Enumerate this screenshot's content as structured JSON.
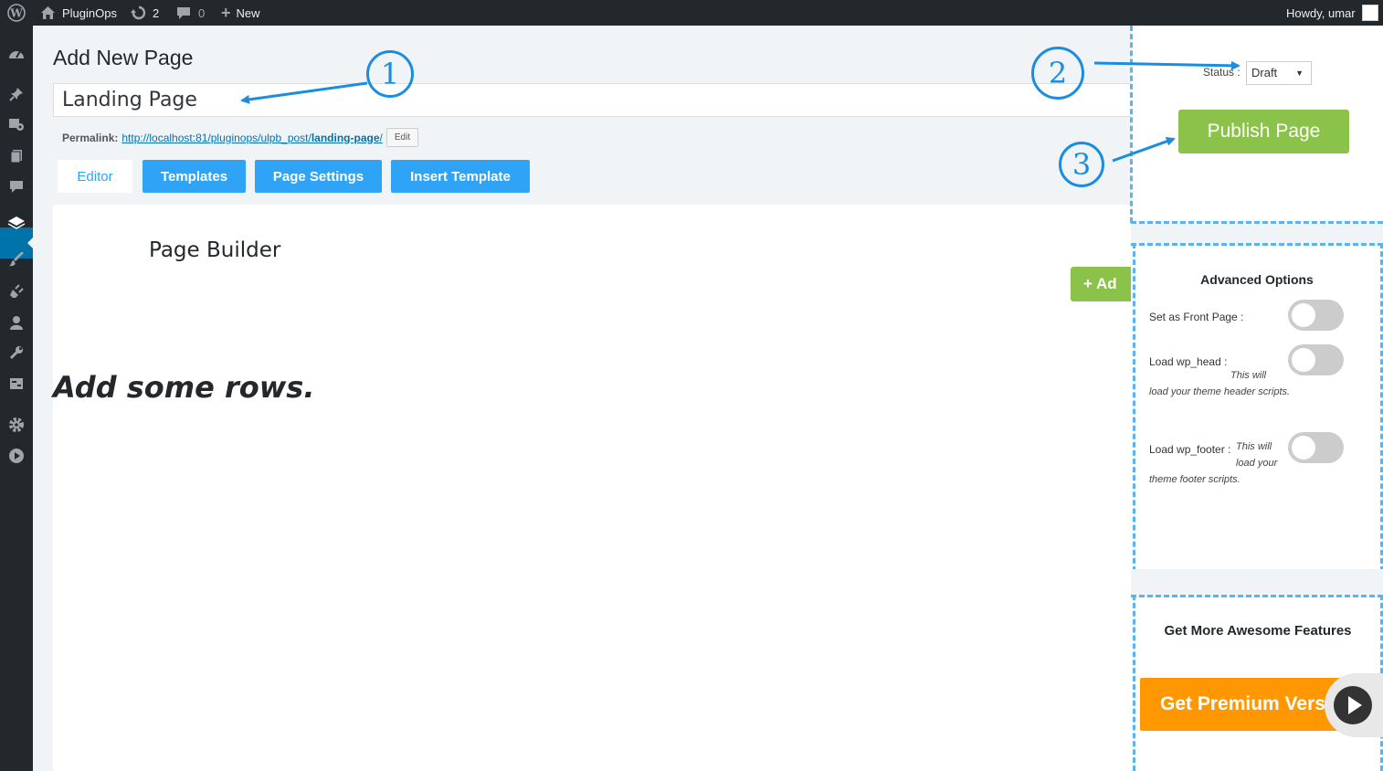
{
  "admin_bar": {
    "site_name": "PluginOps",
    "updates_count": "2",
    "comments_count": "0",
    "new_label": "New",
    "howdy": "Howdy, umar"
  },
  "left_menu": {
    "icons": [
      "dashboard-icon",
      "pin-icon",
      "media-icon",
      "pages-icon",
      "comments-icon",
      "pluginops-icon",
      "appearance-icon",
      "plugins-icon",
      "users-icon",
      "tools-icon",
      "settings-icon",
      "gear-icon",
      "play-icon"
    ]
  },
  "editor": {
    "page_title": "Add New Page",
    "title_value": "Landing Page",
    "permalink_label": "Permalink:",
    "permalink_base": "http://localhost:81/pluginops/ulpb_post/",
    "permalink_slug": "landing-page",
    "permalink_trailing": "/",
    "edit_label": "Edit",
    "tabs": [
      "Editor",
      "Templates",
      "Page Settings",
      "Insert Template"
    ],
    "builder_title": "Page Builder",
    "add_row_label": "+ Ad",
    "empty_message": "Add some rows."
  },
  "sidebar": {
    "status_label": "Status :",
    "status_value": "Draft",
    "publish_label": "Publish Page",
    "advanced_title": "Advanced Options",
    "options": [
      {
        "label": "Set as Front Page :",
        "note": ""
      },
      {
        "label": "Load wp_head :",
        "note_line1": "This will",
        "note_line2": "load your theme header scripts."
      },
      {
        "label": "Load wp_footer :",
        "note_line1": "This will",
        "note_line2": "load your",
        "note_line3": "theme footer scripts."
      }
    ],
    "features_title": "Get More Awesome Features",
    "premium_label": "Get Premium Version"
  },
  "annotations": {
    "marker_1": "1",
    "marker_2": "2",
    "marker_3": "3"
  },
  "colors": {
    "admin_bar": "#23282d",
    "tab_blue": "#2fa3f5",
    "green": "#8bc34a",
    "orange": "#ff9800",
    "annotation_blue": "#1a8de0"
  }
}
